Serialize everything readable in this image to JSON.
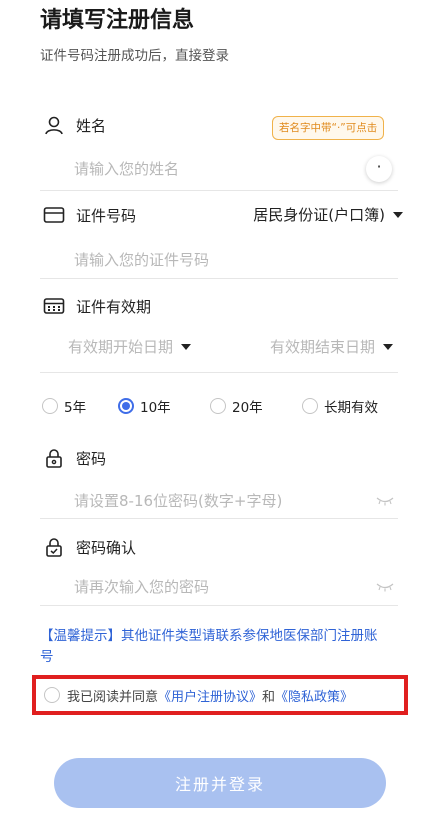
{
  "header": {
    "title": "请填写注册信息",
    "subtitle": "证件号码注册成功后，直接登录"
  },
  "name_field": {
    "label": "姓名",
    "placeholder": "请输入您的姓名",
    "hint": "若名字中带“·”可点击",
    "dot_button": "·",
    "icon": "user-icon"
  },
  "id_field": {
    "label": "证件号码",
    "placeholder": "请输入您的证件号码",
    "doc_type": "居民身份证(户口簿)",
    "icon": "id-card-icon"
  },
  "validity": {
    "label": "证件有效期",
    "start_placeholder": "有效期开始日期",
    "end_placeholder": "有效期结束日期",
    "icon": "calendar-icon",
    "options": [
      {
        "label": "5年",
        "checked": false
      },
      {
        "label": "10年",
        "checked": true
      },
      {
        "label": "20年",
        "checked": false
      },
      {
        "label": "长期有效",
        "checked": false
      }
    ]
  },
  "password": {
    "label": "密码",
    "placeholder": "请设置8-16位密码(数字+字母)",
    "icon": "lock-icon"
  },
  "password_confirm": {
    "label": "密码确认",
    "placeholder": "请再次输入您的密码",
    "icon": "lock-check-icon"
  },
  "tip": "【温馨提示】其他证件类型请联系参保地医保部门注册账号",
  "agreement": {
    "prefix": "我已阅读并同意",
    "user_agreement": "《用户注册协议》",
    "and": "和",
    "privacy_policy": "《隐私政策》"
  },
  "submit_label": "注册并登录",
  "colors": {
    "accent": "#3f6de8",
    "link": "#2f63d6",
    "submit_disabled": "#a9c1f0",
    "highlight_border": "#e01f1f",
    "hint_orange": "#e08a1c"
  }
}
